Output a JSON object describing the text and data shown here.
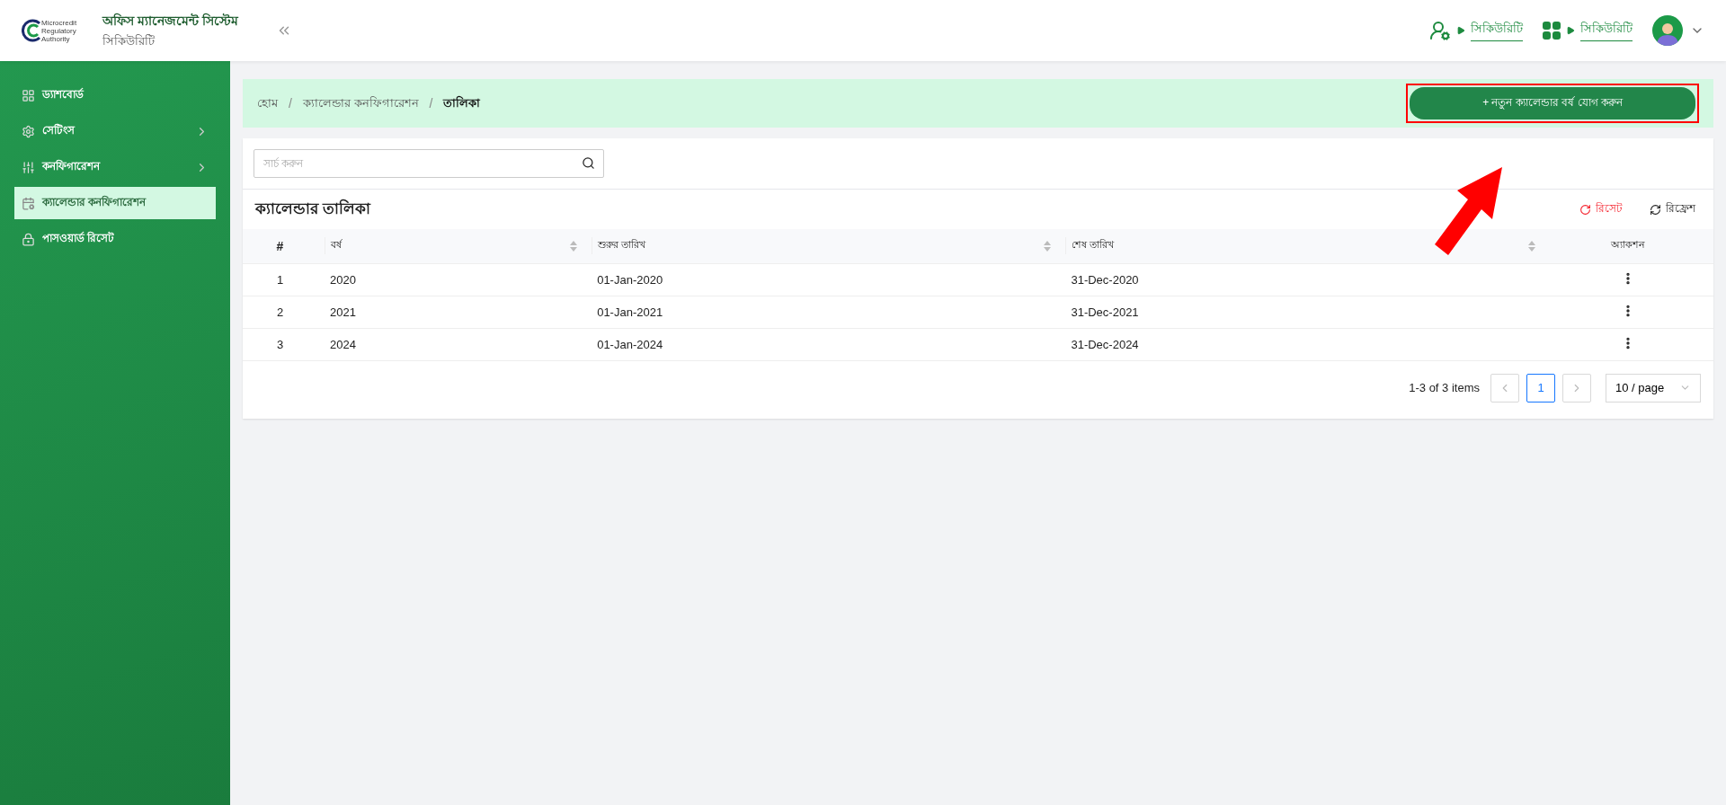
{
  "header": {
    "logo_lines": [
      "Microcredit",
      "Regulatory",
      "Authority"
    ],
    "title": "অফিস ম্যানেজমেন্ট সিস্টেম",
    "subtitle": "সিকিউরিটি",
    "nav_links": [
      {
        "kind": "user-switch",
        "label": "সিকিউরিটি"
      },
      {
        "kind": "apps",
        "label": "সিকিউরিটি"
      }
    ]
  },
  "sidebar": {
    "items": [
      {
        "kind": "dashboard",
        "label": "ড্যাশবোর্ড",
        "selected": false,
        "has_children": false
      },
      {
        "kind": "settings",
        "label": "সেটিংস",
        "selected": false,
        "has_children": true
      },
      {
        "kind": "sliders",
        "label": "কনফিগারেশন",
        "selected": false,
        "has_children": true
      },
      {
        "kind": "calendar",
        "label": "ক্যালেন্ডার কনফিগারেশন",
        "selected": true,
        "has_children": false
      },
      {
        "kind": "lock",
        "label": "পাসওয়ার্ড রিসেট",
        "selected": false,
        "has_children": false
      }
    ]
  },
  "breadcrumb": [
    {
      "label": "হোম",
      "current": false
    },
    {
      "separator": "/",
      "label": "ক্যালেন্ডার কনফিগারেশন",
      "current": false
    },
    {
      "separator": "/",
      "label": "তালিকা",
      "current": true
    }
  ],
  "add_button": "+ নতুন ক্যালেন্ডার বর্ষ যোগ করুন",
  "search": {
    "placeholder": "সার্চ করুন"
  },
  "table": {
    "title": "ক্যালেন্ডার তালিকা",
    "reset": "রিসেট",
    "refresh": "রিফ্রেশ",
    "columns": [
      {
        "label": "#",
        "sortable": false
      },
      {
        "label": "বর্ষ",
        "sortable": true
      },
      {
        "label": "শুরুর তারিখ",
        "sortable": true
      },
      {
        "label": "শেষ তারিখ",
        "sortable": true
      },
      {
        "label": "অ্যাকশন",
        "sortable": false
      }
    ],
    "rows": [
      [
        "1",
        "2020",
        "01-Jan-2020",
        "31-Dec-2020"
      ],
      [
        "2",
        "2021",
        "01-Jan-2021",
        "31-Dec-2021"
      ],
      [
        "3",
        "2024",
        "01-Jan-2024",
        "31-Dec-2024"
      ]
    ]
  },
  "pagination": {
    "summary": "1-3 of 3 items",
    "pages": [
      {
        "label": "1",
        "selected": true
      }
    ],
    "page_size": "10 / page"
  }
}
